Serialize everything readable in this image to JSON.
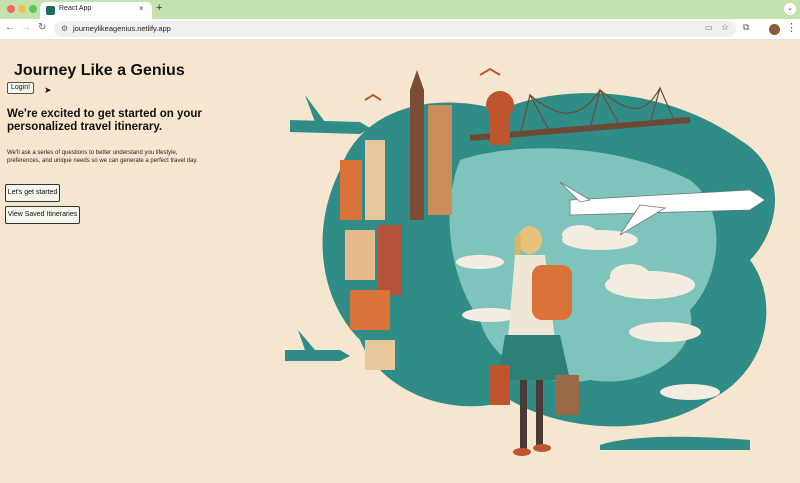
{
  "browser": {
    "tab_title": "React App",
    "tab_close": "×",
    "new_tab": "+",
    "tab_menu": "⌄",
    "url": "journeylikeagenius.netlify.app",
    "icons": [
      "back-icon",
      "forward-icon",
      "reload-icon",
      "site-settings-icon",
      "cast-icon",
      "bookmark-star-icon",
      "extensions-icon",
      "profile-avatar",
      "more-menu-icon"
    ]
  },
  "app": {
    "title": "Journey Like a Genius",
    "login_label": "Login!",
    "headline": "We're excited to get started on your personalized travel itinerary.",
    "subtext": "We'll ask a series of questions to better understand you lifestyle, preferences, and unique needs so we can generate a perfect travel day.",
    "start_label": "Let's get started",
    "saved_label": "View Saved Itineraries"
  },
  "colors": {
    "page_bg": "#f6e6cf",
    "tab_strip": "#c4e2b0",
    "teal": "#2f8c86",
    "orange": "#d9733a"
  }
}
